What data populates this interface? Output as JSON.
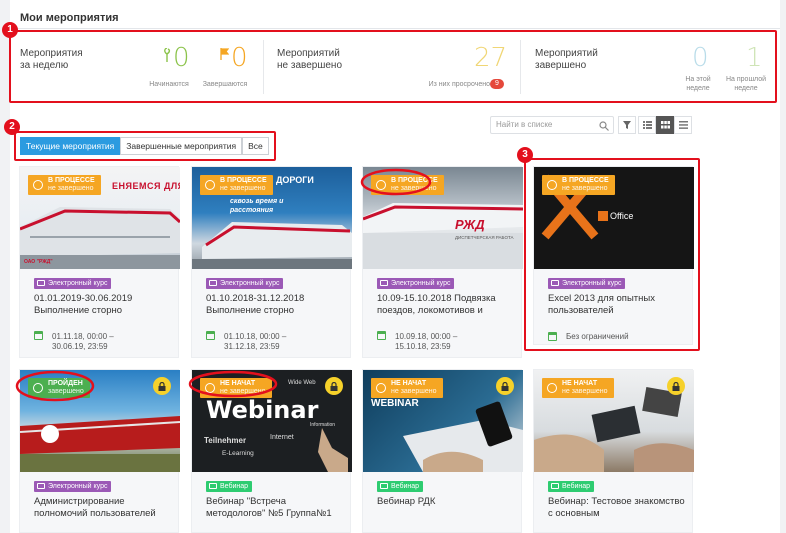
{
  "page_title": "Мои мероприятия",
  "stats": [
    {
      "label_1": "Мероприятия",
      "label_2": "за неделю",
      "values": [
        {
          "num": "0",
          "caption": "Начинаются",
          "color": "#8bc34a"
        },
        {
          "num": "0",
          "caption": "Завершаются",
          "color": "#f5a623"
        }
      ]
    },
    {
      "label_1": "Мероприятий",
      "label_2": "не завершено",
      "values": [
        {
          "num": "27",
          "caption": "Из них просрочено",
          "color": "#f0d675",
          "pill": "9"
        }
      ]
    },
    {
      "label_1": "Мероприятий",
      "label_2": "завершено",
      "values": [
        {
          "num": "0",
          "caption_1": "На этой",
          "caption_2": "неделе",
          "color": "#b9dce9"
        },
        {
          "num": "1",
          "caption_1": "На прошлой",
          "caption_2": "неделе",
          "color": "#cfe4b6"
        }
      ]
    }
  ],
  "annotations": [
    "1",
    "2",
    "3"
  ],
  "search": {
    "placeholder": "Найти в списке"
  },
  "tabs": [
    {
      "label": "Текущие мероприятия",
      "active": true
    },
    {
      "label": "Завершенные мероприятия",
      "active": false
    },
    {
      "label": "Все",
      "active": false
    }
  ],
  "cards": [
    {
      "status_1": "В ПРОЦЕССЕ",
      "status_2": "не завершено",
      "status_color": "#f5a623",
      "image_text": "ЕНЯЕМСЯ ДЛЯ ВАС",
      "image_sub": "ОАО \"РЖД\"",
      "type": "Электронный курс",
      "type_color": "#9b59b6",
      "title": "01.01.2019-30.06.2019 Выполнение сторно",
      "date_1": "01.11.18, 00:00 –",
      "date_2": "30.06.19, 23:59"
    },
    {
      "status_1": "В ПРОЦЕССЕ",
      "status_2": "не завершено",
      "status_color": "#f5a623",
      "image_text": "ДОРОГИ",
      "image_sub": "сквозь время и расстояния",
      "type": "Электронный курс",
      "type_color": "#9b59b6",
      "title": "01.10.2018-31.12.2018 Выполнение сторно",
      "date_1": "01.10.18, 00:00 –",
      "date_2": "31.12.18, 23:59"
    },
    {
      "status_1": "В ПРОЦЕССЕ",
      "status_2": "не завершено",
      "status_color": "#f5a623",
      "image_text": "РЖД",
      "image_sub": "ДИСПЕТЧЕРСКАЯ РАБОТА",
      "type": "Электронный курс",
      "type_color": "#9b59b6",
      "title": "10.09-15.10.2018 Подвязка поездов, локомотивов и",
      "date_1": "10.09.18, 00:00 –",
      "date_2": "15.10.18, 23:59"
    },
    {
      "status_1": "В ПРОЦЕССЕ",
      "status_2": "не завершено",
      "status_color": "#f5a623",
      "image_text": "Office",
      "type": "Электронный курс",
      "type_color": "#9b59b6",
      "title": "Excel 2013 для опытных пользователей",
      "date_1": "Без ограничений"
    },
    {
      "status_1": "ПРОЙДЕН",
      "status_2": "завершено",
      "status_color": "#4caf50",
      "type": "Электронный курс",
      "type_color": "#9b59b6",
      "title": "Администрирование полномочий пользователей"
    },
    {
      "status_1": "НЕ НАЧАТ",
      "status_2": "не завершено",
      "status_color": "#f5a623",
      "image_text": "Webinar",
      "image_words": [
        "Teilnehmer",
        "Internet",
        "E-Learning",
        "Wide Web",
        "Information"
      ],
      "type": "Вебинар",
      "type_color": "#2ecc71",
      "title": "Вебинар \"Встреча методологов\" №5 Группа№1"
    },
    {
      "status_1": "НЕ НАЧАТ",
      "status_2": "не завершено",
      "status_color": "#f5a623",
      "image_text": "WEBINAR",
      "type": "Вебинар",
      "type_color": "#2ecc71",
      "title": "Вебинар РДК"
    },
    {
      "status_1": "НЕ НАЧАТ",
      "status_2": "не завершено",
      "status_color": "#f5a623",
      "type": "Вебинар",
      "type_color": "#2ecc71",
      "title": "Вебинар: Тестовое знакомство с основным"
    }
  ]
}
